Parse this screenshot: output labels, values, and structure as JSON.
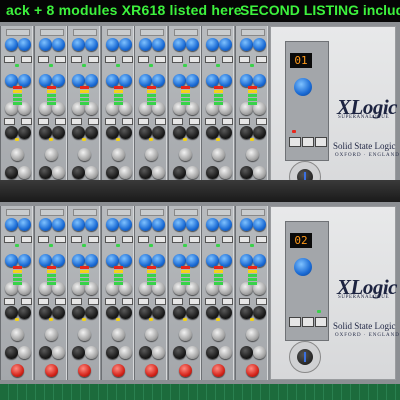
{
  "banner": {
    "left_text": "ack + 8 modules XR618 listed here",
    "right_text": "SECOND LISTING includes",
    "color": "#3df23d"
  },
  "racks": [
    {
      "channel_display": "01",
      "logo": "XLogic",
      "logo_sub": "SUPERANALOGUE",
      "maker": "Solid State Logic",
      "maker_sub": "OXFORD · ENGLAND",
      "modules": 8
    },
    {
      "channel_display": "02",
      "logo": "XLogic",
      "logo_sub": "SUPERANALOGUE",
      "maker": "Solid State Logic",
      "maker_sub": "OXFORD · ENGLAND",
      "modules": 8
    }
  ],
  "colors": {
    "knob_blue": "#1a6ad4",
    "display_digits": "#ff9a1a",
    "led_green": "#39d24a",
    "led_yellow": "#f2d21a",
    "led_red": "#e8261a"
  }
}
